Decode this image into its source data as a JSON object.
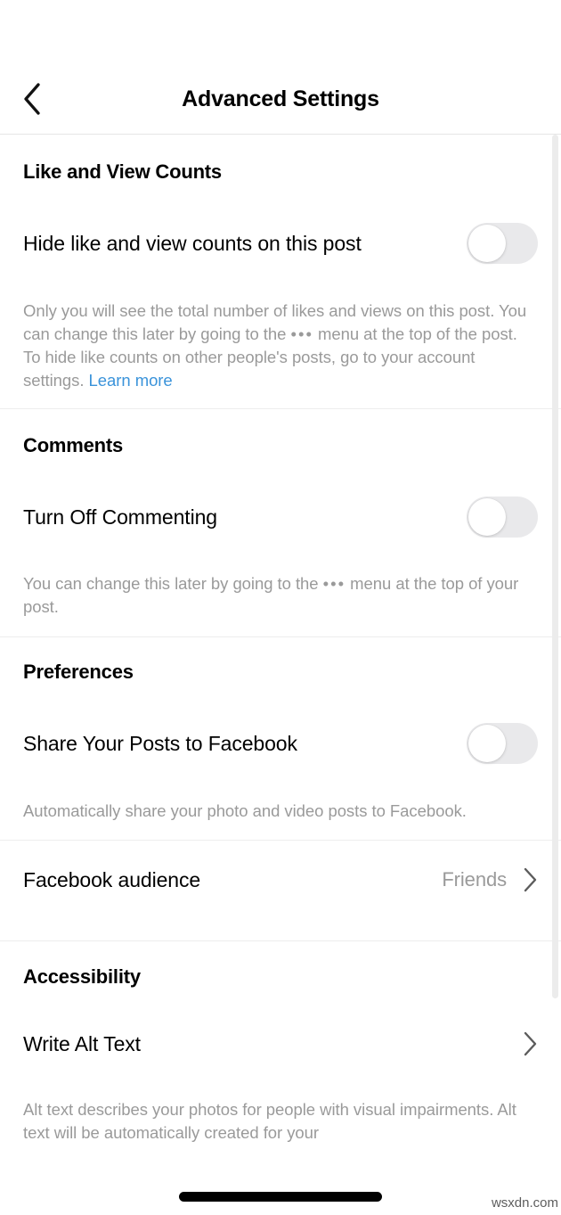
{
  "header": {
    "title": "Advanced Settings",
    "back_icon": "chevron-left-icon"
  },
  "sections": [
    {
      "id": "like-and-view-counts",
      "title": "Like and View Counts",
      "rows": [
        {
          "type": "toggle",
          "label": "Hide like and view counts on this post",
          "state": "off"
        }
      ],
      "helper_before_dots": "Only you will see the total number of likes and views on this post. You can change this later by going to the ",
      "helper_dots": "•••",
      "helper_after_dots": " menu at the top of the post. To hide like counts on other people's posts, go to your account settings. ",
      "helper_link": "Learn more"
    },
    {
      "id": "comments",
      "title": "Comments",
      "rows": [
        {
          "type": "toggle",
          "label": "Turn Off Commenting",
          "state": "off"
        }
      ],
      "helper_before_dots": "You can change this later by going to the ",
      "helper_dots": "•••",
      "helper_after_dots": " menu at the top of your post."
    },
    {
      "id": "preferences",
      "title": "Preferences",
      "rows": [
        {
          "type": "toggle",
          "label": "Share Your Posts to Facebook",
          "state": "off"
        }
      ],
      "helper": "Automatically share your photo and video posts to Facebook."
    },
    {
      "id": "facebook-audience",
      "rows": [
        {
          "type": "disclosure",
          "label": "Facebook audience",
          "value": "Friends",
          "chevron_icon": "chevron-right-icon"
        }
      ]
    },
    {
      "id": "accessibility",
      "title": "Accessibility",
      "rows": [
        {
          "type": "disclosure",
          "label": "Write Alt Text",
          "value": "",
          "chevron_icon": "chevron-right-icon"
        }
      ],
      "helper": "Alt text describes your photos for people with visual impairments. Alt text will be automatically created for your"
    }
  ],
  "colors": {
    "link": "#3a93da",
    "toggle_off_track": "#e9e9eb",
    "helper_text": "#9a9a9a",
    "divider": "#ededed",
    "scrollbar": "#ececec"
  },
  "watermark": "wsxdn.com"
}
